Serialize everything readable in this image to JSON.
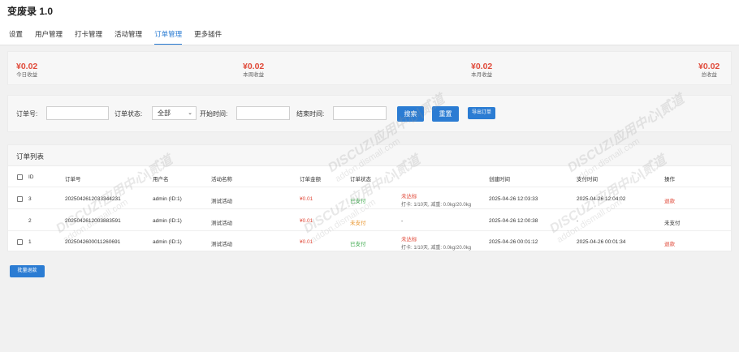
{
  "app": {
    "title": "变废录 1.0"
  },
  "tabs": [
    {
      "label": "设置"
    },
    {
      "label": "用户管理"
    },
    {
      "label": "打卡管理"
    },
    {
      "label": "活动管理"
    },
    {
      "label": "订单管理"
    },
    {
      "label": "更多插件"
    }
  ],
  "active_tab": "订单管理",
  "stats": [
    {
      "value": "¥0.02",
      "label": "今日收益"
    },
    {
      "value": "¥0.02",
      "label": "本周收益"
    },
    {
      "value": "¥0.02",
      "label": "本月收益"
    },
    {
      "value": "¥0.02",
      "label": "总收益"
    }
  ],
  "filter": {
    "order_no_label": "订单号:",
    "order_no_value": "",
    "status_label": "订单状态:",
    "status_value": "全部",
    "start_label": "开始时间:",
    "start_value": "",
    "end_label": "结束时间:",
    "end_value": "",
    "search_label": "搜索",
    "reset_label": "重置",
    "export_label": "导出订单"
  },
  "table": {
    "title": "订单列表",
    "headers": {
      "id": "ID",
      "order_no": "订单号",
      "user": "用户名",
      "activity": "活动名称",
      "amount": "订单金额",
      "status": "订单状态",
      "created": "创建时间",
      "paid": "支付时间",
      "action": "操作"
    },
    "rows": [
      {
        "id": "3",
        "order_no": "2025042612033344231",
        "user": "admin (ID:1)",
        "activity": "测试活动",
        "amount": "¥0.01",
        "status": "已支付",
        "progress_status": "未达标",
        "progress_detail": "打卡: 1/10天, 减重: 0.0kg/20.0kg",
        "created": "2025-04-26 12:03:33",
        "paid": "2025-04-26 12:04:02",
        "action": "退款"
      },
      {
        "id": "2",
        "order_no": "2025042612003883591",
        "user": "admin (ID:1)",
        "activity": "测试活动",
        "amount": "¥0.01",
        "status": "未支付",
        "progress_status": "-",
        "progress_detail": "",
        "created": "2025-04-26 12:00:38",
        "paid": "-",
        "action": "未支付"
      },
      {
        "id": "1",
        "order_no": "2025042600011260691",
        "user": "admin (ID:1)",
        "activity": "测试活动",
        "amount": "¥0.01",
        "status": "已支付",
        "progress_status": "未达标",
        "progress_detail": "打卡: 1/10天, 减重: 0.0kg/20.0kg",
        "created": "2025-04-26 00:01:12",
        "paid": "2025-04-26 00:01:34",
        "action": "退款"
      }
    ]
  },
  "batch_refund_label": "批量退款",
  "watermark": {
    "brand": "DISCUZ!应用中心|贰道",
    "domain": "addon.dismall.com"
  },
  "colors": {
    "accent": "#2b7cd3",
    "money": "#e04a3a",
    "paid": "#3aa84a",
    "unpaid": "#e8932a"
  }
}
